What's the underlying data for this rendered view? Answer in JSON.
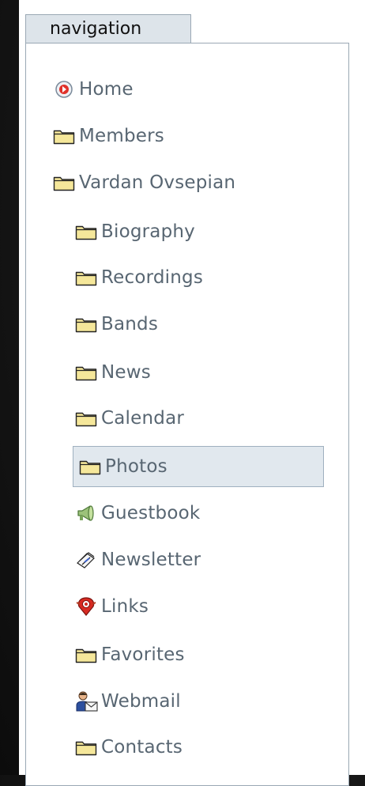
{
  "nav": {
    "tab_label": "navigation",
    "items": [
      {
        "label": "Home",
        "icon": "home-icon",
        "level": 0
      },
      {
        "label": "Members",
        "icon": "folder-icon",
        "level": 0
      },
      {
        "label": "Vardan Ovsepian",
        "icon": "folder-icon",
        "level": 0
      },
      {
        "label": "Biography",
        "icon": "folder-icon",
        "level": 1
      },
      {
        "label": "Recordings",
        "icon": "folder-icon",
        "level": 1
      },
      {
        "label": "Bands",
        "icon": "folder-icon",
        "level": 1
      },
      {
        "label": "News",
        "icon": "folder-icon",
        "level": 1
      },
      {
        "label": "Calendar",
        "icon": "folder-icon",
        "level": 1
      },
      {
        "label": "Photos",
        "icon": "folder-icon",
        "level": 1,
        "selected": true
      },
      {
        "label": "Guestbook",
        "icon": "megaphone-icon",
        "level": 1
      },
      {
        "label": "Newsletter",
        "icon": "newsletter-icon",
        "level": 1
      },
      {
        "label": "Links",
        "icon": "links-icon",
        "level": 1
      },
      {
        "label": "Favorites",
        "icon": "folder-icon",
        "level": 1
      },
      {
        "label": "Webmail",
        "icon": "webmail-icon",
        "level": 1
      },
      {
        "label": "Contacts",
        "icon": "folder-icon",
        "level": 1
      }
    ]
  },
  "colors": {
    "text": "#586672",
    "selected_bg": "#e1e8ee",
    "border": "#9aa8b4",
    "folder": "#f5e79a"
  }
}
